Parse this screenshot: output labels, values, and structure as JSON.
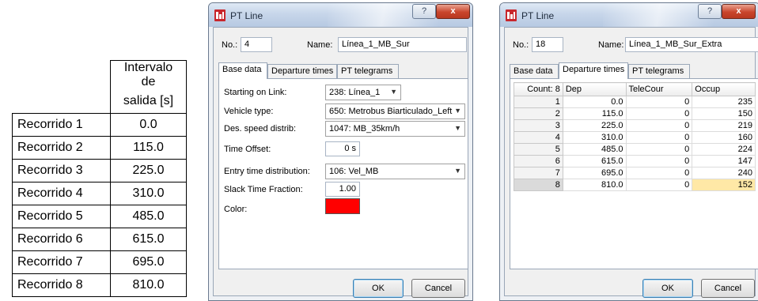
{
  "spreadsheet": {
    "header_line1": "Intervalo de",
    "header_line2": "salida [s]",
    "rows": [
      {
        "name": "Recorrido 1",
        "value": "0.0"
      },
      {
        "name": "Recorrido 2",
        "value": "115.0"
      },
      {
        "name": "Recorrido 3",
        "value": "225.0"
      },
      {
        "name": "Recorrido 4",
        "value": "310.0"
      },
      {
        "name": "Recorrido 5",
        "value": "485.0"
      },
      {
        "name": "Recorrido 6",
        "value": "615.0"
      },
      {
        "name": "Recorrido 7",
        "value": "695.0"
      },
      {
        "name": "Recorrido 8",
        "value": "810.0"
      }
    ]
  },
  "dialog1": {
    "title": "PT Line",
    "help_label": "?",
    "close_label": "x",
    "no_label": "No.:",
    "no_value": "4",
    "name_label": "Name:",
    "name_value": "Línea_1_MB_Sur",
    "tabs": [
      "Base data",
      "Departure times",
      "PT telegrams"
    ],
    "fields": {
      "starting_link_label": "Starting on Link:",
      "starting_link_value": "238: Línea_1",
      "vehicle_type_label": "Vehicle type:",
      "vehicle_type_value": "650: Metrobus Biarticulado_Left",
      "speed_label": "Des. speed distrib:",
      "speed_value": "1047: MB_35km/h",
      "time_offset_label": "Time Offset:",
      "time_offset_value": "0 s",
      "entry_label": "Entry time distribution:",
      "entry_value": "106: Vel_MB",
      "slack_label": "Slack Time Fraction:",
      "slack_value": "1.00",
      "color_label": "Color:"
    },
    "color_swatch": "#ff0000",
    "ok_label": "OK",
    "cancel_label": "Cancel"
  },
  "dialog2": {
    "title": "PT Line",
    "help_label": "?",
    "close_label": "x",
    "no_label": "No.:",
    "no_value": "18",
    "name_label": "Name:",
    "name_value": "Línea_1_MB_Sur_Extra",
    "tabs": [
      "Base data",
      "Departure times",
      "PT telegrams"
    ],
    "grid": {
      "columns": [
        "Count: 8",
        "Dep",
        "TeleCour",
        "Occup"
      ],
      "rows": [
        {
          "n": "1",
          "dep": "0.0",
          "tele": "0",
          "occ": "235"
        },
        {
          "n": "2",
          "dep": "115.0",
          "tele": "0",
          "occ": "150"
        },
        {
          "n": "3",
          "dep": "225.0",
          "tele": "0",
          "occ": "219"
        },
        {
          "n": "4",
          "dep": "310.0",
          "tele": "0",
          "occ": "160"
        },
        {
          "n": "5",
          "dep": "485.0",
          "tele": "0",
          "occ": "224"
        },
        {
          "n": "6",
          "dep": "615.0",
          "tele": "0",
          "occ": "147"
        },
        {
          "n": "7",
          "dep": "695.0",
          "tele": "0",
          "occ": "240"
        },
        {
          "n": "8",
          "dep": "810.0",
          "tele": "0",
          "occ": "152"
        }
      ]
    },
    "ok_label": "OK",
    "cancel_label": "Cancel"
  },
  "colors": {
    "selected_cell": "#ffe8a6",
    "app_icon": "#c8262c"
  }
}
